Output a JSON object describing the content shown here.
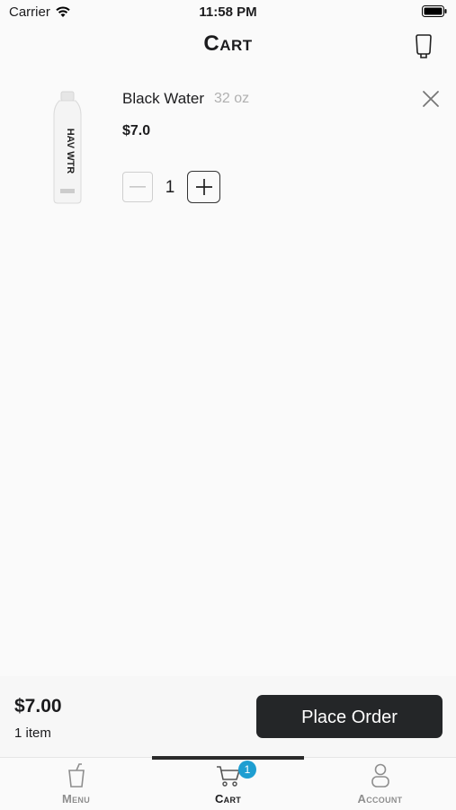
{
  "status_bar": {
    "carrier": "Carrier",
    "time": "11:58 PM"
  },
  "header": {
    "title": "Cart"
  },
  "cart": {
    "items": [
      {
        "name": "Black Water",
        "size": "32 oz",
        "price": "$7.0",
        "quantity": "1",
        "bottle_text": "HAV WTR"
      }
    ]
  },
  "summary": {
    "total": "$7.00",
    "item_count": "1 item",
    "place_order_label": "Place Order"
  },
  "tabs": [
    {
      "label": "Menu",
      "icon": "cup-icon"
    },
    {
      "label": "Cart",
      "icon": "cart-icon",
      "badge": "1"
    },
    {
      "label": "Account",
      "icon": "person-icon"
    }
  ],
  "colors": {
    "accent_badge": "#1e9ed1",
    "button_dark": "#242628",
    "muted_text": "#b0b0b0"
  }
}
